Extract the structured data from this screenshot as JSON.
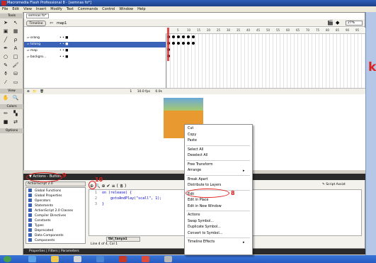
{
  "window": {
    "title": "Macromedia Flash Professional 8 - [semnas fo*]"
  },
  "menubar": [
    "File",
    "Edit",
    "View",
    "Insert",
    "Modify",
    "Text",
    "Commands",
    "Control",
    "Window",
    "Help"
  ],
  "tools": {
    "header_tools": "Tools",
    "header_view": "View",
    "header_colors": "Colors",
    "header_options": "Options"
  },
  "document": {
    "tab": "semnas fo*",
    "timeline_button": "Timeline",
    "scene": "map1",
    "zoom": "27%"
  },
  "timeline": {
    "layers": [
      {
        "name": "orang",
        "selected": false
      },
      {
        "name": "tolong",
        "selected": true
      },
      {
        "name": "map",
        "selected": false
      },
      {
        "name": "backgro...",
        "selected": false
      }
    ],
    "ruler": [
      "1",
      "5",
      "10",
      "15",
      "20",
      "25",
      "30",
      "35",
      "40",
      "45",
      "50",
      "55",
      "60",
      "65",
      "70",
      "75",
      "80",
      "85",
      "90",
      "95"
    ],
    "footer": {
      "frame": "1",
      "fps": "10.0 fps",
      "time": "0.0s"
    }
  },
  "actions": {
    "panel_title": "Actions - Button",
    "category_select": "ActionScript 2.0",
    "categories": [
      "Global Functions",
      "Global Properties",
      "Operators",
      "Statements",
      "ActionScript 2.0 Classes",
      "Compiler Directives",
      "Constants",
      "Types",
      "Deprecated",
      "Data Components",
      "Components"
    ],
    "script_assist": "Script Assist",
    "code_lines": [
      {
        "num": "1",
        "text": "on (release) {"
      },
      {
        "num": "2",
        "text": "    gotoAndPlay(\"scall\", 1);"
      },
      {
        "num": "3",
        "text": "}"
      }
    ],
    "script_tab": "tbl_tanya1",
    "status": "Line 4 of 4, Col 1"
  },
  "properties_bar": "Properties | Filters | Parameters",
  "context_menu": {
    "groups": [
      [
        "Cut",
        "Copy",
        "Paste"
      ],
      [
        "Select All",
        "Deselect All"
      ],
      [
        "Free Transform",
        "Arrange"
      ],
      [
        "Break Apart",
        "Distribute to Layers"
      ],
      [
        "Edit",
        "Edit in Place",
        "Edit in New Window"
      ],
      [
        "Actions",
        "Swap Symbol...",
        "Duplicate Symbol...",
        "Convert to Symbol..."
      ],
      [
        "Timeline Effects"
      ]
    ],
    "submenu_items": [
      "Arrange",
      "Timeline Effects"
    ]
  },
  "annotations": {
    "a8": "8",
    "a9": "9",
    "a10": "10"
  },
  "colors": {
    "accent": "#3a63b8",
    "annotation": "#e01b1b",
    "panel_dark": "#2a2a2a"
  }
}
